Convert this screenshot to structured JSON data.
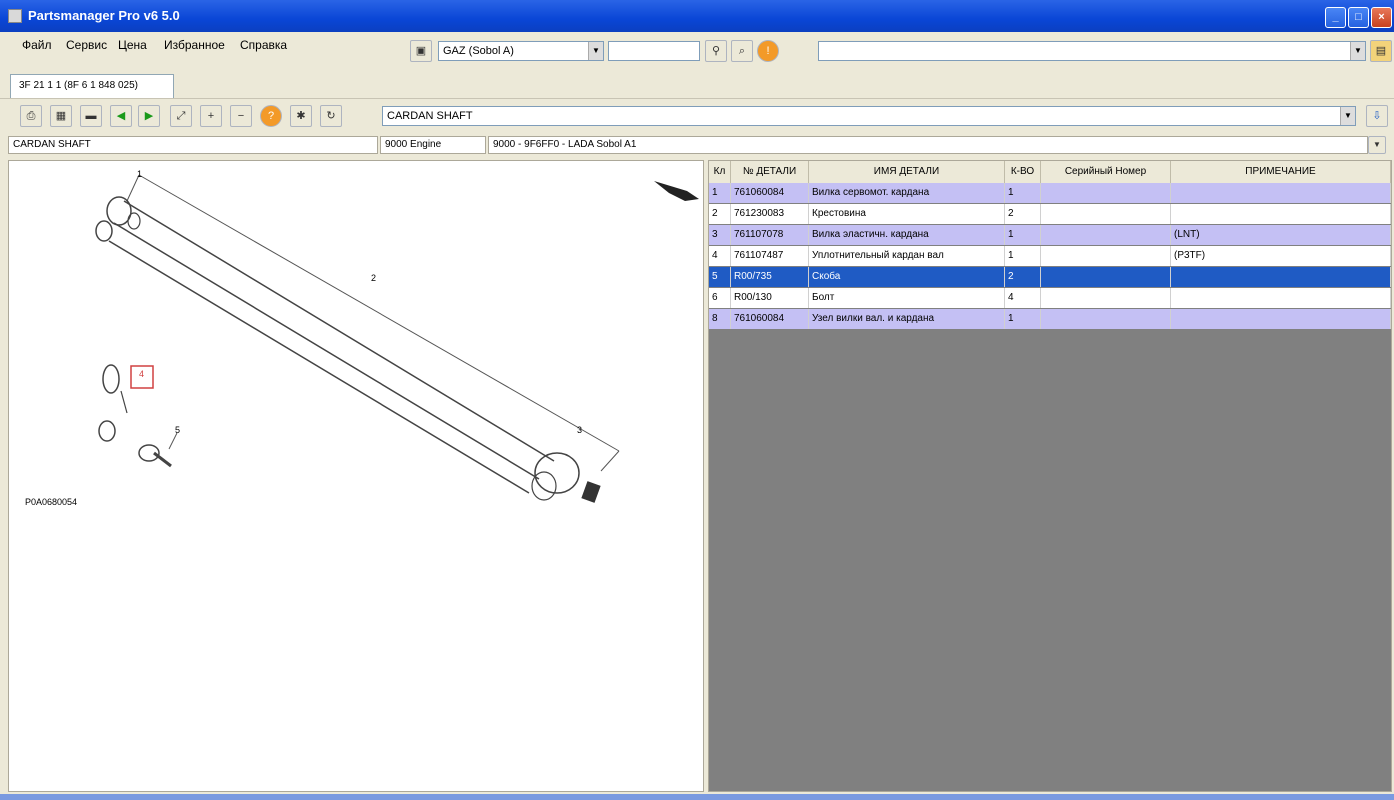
{
  "window": {
    "title": "Partsmanager Pro v6 5.0"
  },
  "menu": [
    "Файл",
    "Сервис",
    "Цена",
    "Избранное",
    "Справка"
  ],
  "toolbar1": {
    "model_combo": "GAZ (Sobol A)",
    "search_value": "",
    "path_combo": ""
  },
  "tab": {
    "label": "3F 21 1 1 (8F 6 1 848 025)"
  },
  "toolbar2": {
    "group_combo": "CARDAN SHAFT"
  },
  "info": {
    "cell1": "CARDAN SHAFT",
    "cell2": "9000 Engine",
    "cell3": "9000 - 9F6FF0 - LADA Sobol A1"
  },
  "diagram": {
    "callout_1": "1",
    "callout_2": "2",
    "callout_3": "3",
    "callout_4": "4",
    "callout_5": "5",
    "ref_code": "P0A0680054"
  },
  "parts": {
    "headers": [
      "Кл",
      "№ ДЕТАЛИ",
      "ИМЯ ДЕТАЛИ",
      "К-ВО",
      "Серийный Номер",
      "ПРИМЕЧАНИЕ"
    ],
    "rows": [
      {
        "idx": "1",
        "number": "761060084",
        "name": "Вилка сервомот. кардана",
        "qty": "1",
        "serial": "",
        "note": ""
      },
      {
        "idx": "2",
        "number": "761230083",
        "name": "Крестовина",
        "qty": "2",
        "serial": "",
        "note": ""
      },
      {
        "idx": "3",
        "number": "761107078",
        "name": "Вилка эластичн. кардана",
        "qty": "1",
        "serial": "",
        "note": "(LNT)"
      },
      {
        "idx": "4",
        "number": "761107487",
        "name": "Уплотнительный кардан вал",
        "qty": "1",
        "serial": "",
        "note": "(P3TF)"
      },
      {
        "idx": "5",
        "number": "R00/735",
        "name": "Скоба",
        "qty": "2",
        "serial": "",
        "note": ""
      },
      {
        "idx": "6",
        "number": "R00/130",
        "name": "Болт",
        "qty": "4",
        "serial": "",
        "note": ""
      },
      {
        "idx": "8",
        "number": "761060084",
        "name": "Узел вилки вал. и кардана",
        "qty": "1",
        "serial": "",
        "note": ""
      }
    ],
    "selected_index": 4
  }
}
